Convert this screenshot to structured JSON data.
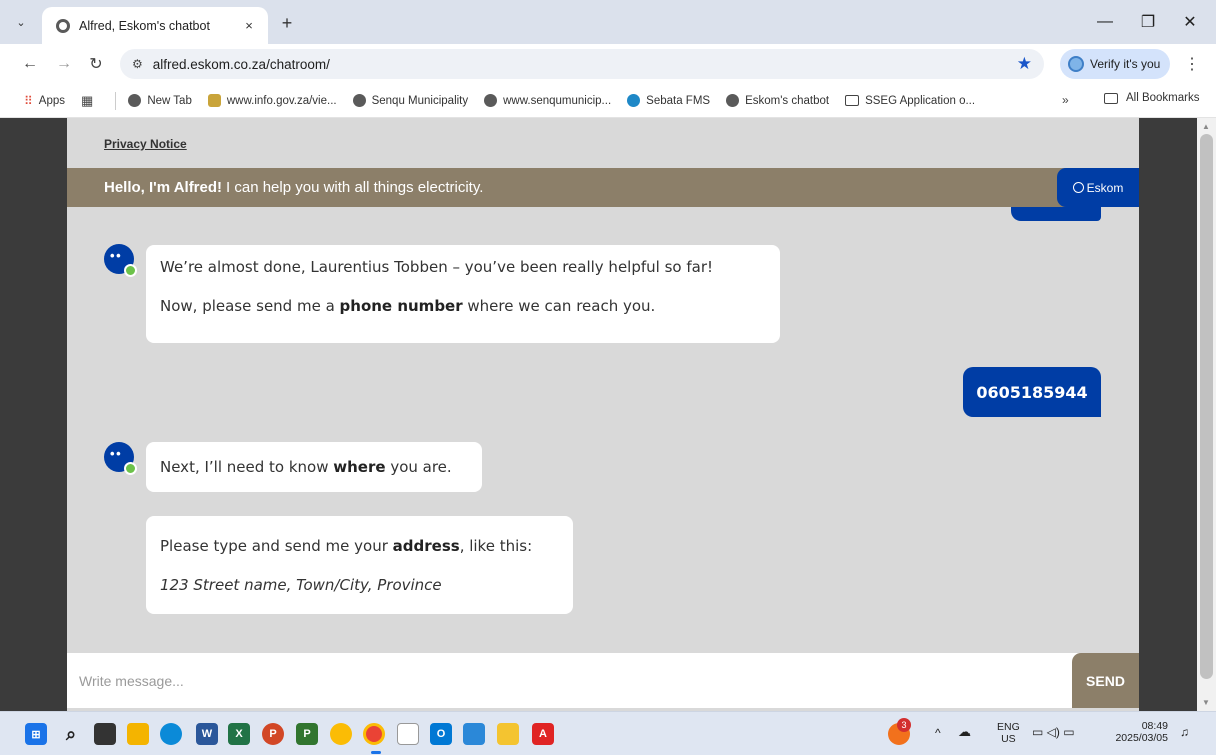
{
  "browser": {
    "tab_title": "Alfred, Eskom's chatbot",
    "tab_close": "×",
    "new_tab": "+",
    "tab_menu": "⌄",
    "url": "alfred.eskom.co.za/chatroom/",
    "verify_label": "Verify it's you",
    "window_controls": {
      "minimize": "—",
      "restore": "❐",
      "close": "✕"
    },
    "nav": {
      "back": "←",
      "forward": "→",
      "reload": "↻",
      "menu": "⋮",
      "star": "★"
    }
  },
  "bookmarks": {
    "items": [
      {
        "label": "Apps",
        "icon": "apps-grid-icon"
      },
      {
        "label": "",
        "icon": "tab-groups-icon"
      },
      {
        "label": "New Tab",
        "icon": "globe-icon"
      },
      {
        "label": "www.info.gov.za/vie...",
        "icon": "sa-coat-of-arms-icon"
      },
      {
        "label": "Senqu Municipality",
        "icon": "globe-icon"
      },
      {
        "label": "www.senqumunicip...",
        "icon": "globe-icon"
      },
      {
        "label": "Sebata FMS",
        "icon": "sebata-icon"
      },
      {
        "label": "Eskom's chatbot",
        "icon": "globe-icon"
      },
      {
        "label": "SSEG Application o...",
        "icon": "folder-icon"
      }
    ],
    "more": "»",
    "all_bookmarks": "All Bookmarks"
  },
  "chat": {
    "privacy_notice": "Privacy Notice",
    "header_bold": "Hello, I'm Alfred!",
    "header_rest": "I can help you with all things electricity.",
    "brand": "Eskom",
    "messages": [
      {
        "line1": "We’re almost done, Laurentius Tobben – you’ve been really helpful so far!",
        "line2_pre": "Now, please send me a ",
        "line2_bold": "phone number",
        "line2_post": " where we can reach you."
      },
      {
        "text": "0605185944"
      },
      {
        "pre": "Next, I’ll need to know ",
        "bold": "where",
        "post": " you are."
      },
      {
        "pre": "Please type and send me your ",
        "bold": "address",
        "post": ", like this:",
        "example": "123 Street name, Town/City, Province"
      }
    ],
    "composer_placeholder": "Write message...",
    "send_label": "SEND"
  },
  "taskbar": {
    "notification_count": "3",
    "language": "ENG",
    "region": "US",
    "time": "08:49",
    "date": "2025/03/05",
    "colors": {
      "eskom_blue": "#003da5",
      "alfred_brown": "#8c7f69",
      "online_green": "#6cc24a"
    }
  }
}
